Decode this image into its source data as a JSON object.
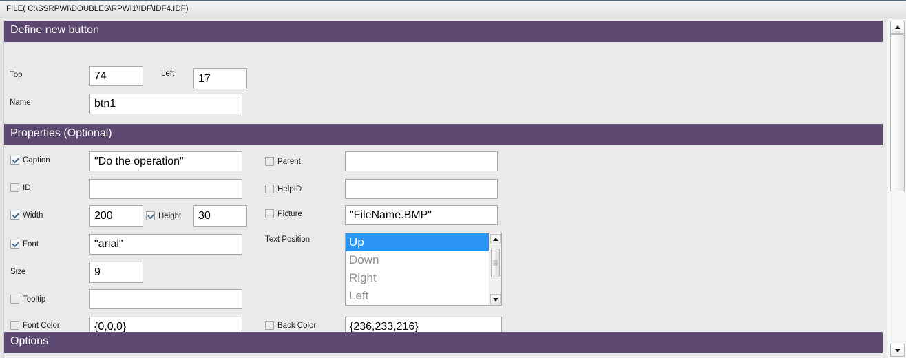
{
  "window": {
    "file_path_label": "FILE( C:\\SSRPWI\\DOUBLES\\RPWI1\\IDF\\IDF4.IDF)"
  },
  "colors": {
    "section_header_bg": "#5d4871",
    "panel_bg": "#eaeaea",
    "selection_blue": "#2a95f2",
    "input_bg": "#ffffff",
    "text": "#242424"
  },
  "sections": {
    "define": {
      "title": "Define new button",
      "fields": {
        "top_label": "Top",
        "top_value": "74",
        "left_label": "Left",
        "left_value": "17",
        "name_label": "Name",
        "name_value": "btn1"
      }
    },
    "properties": {
      "title": "Properties (Optional)",
      "left_column": [
        {
          "name": "caption",
          "label": "Caption",
          "checked": true,
          "has_checkbox": true,
          "value": "\"Do the operation\""
        },
        {
          "name": "id",
          "label": "ID",
          "checked": false,
          "has_checkbox": true,
          "value": ""
        },
        {
          "name": "width",
          "label": "Width",
          "checked": true,
          "has_checkbox": true,
          "value": "200"
        },
        {
          "name": "height",
          "label": "Height",
          "checked": true,
          "has_checkbox": true,
          "value": "30"
        },
        {
          "name": "font",
          "label": "Font",
          "checked": true,
          "has_checkbox": true,
          "value": "\"arial\""
        },
        {
          "name": "size",
          "label": "Size",
          "checked": false,
          "has_checkbox": false,
          "value": "9"
        },
        {
          "name": "tooltip",
          "label": "Tooltip",
          "checked": false,
          "has_checkbox": true,
          "value": ""
        },
        {
          "name": "font-color",
          "label": "Font Color",
          "checked": false,
          "has_checkbox": true,
          "value": "{0,0,0}"
        }
      ],
      "right_column": [
        {
          "name": "parent",
          "label": "Parent",
          "checked": false,
          "has_checkbox": true,
          "value": ""
        },
        {
          "name": "help-id",
          "label": "HelpID",
          "checked": false,
          "has_checkbox": true,
          "value": ""
        },
        {
          "name": "picture",
          "label": "Picture",
          "checked": false,
          "has_checkbox": true,
          "value": "\"FileName.BMP\""
        },
        {
          "name": "text-position",
          "label": "Text Position",
          "checked": false,
          "has_checkbox": false,
          "value": ""
        },
        {
          "name": "back-color",
          "label": "Back Color",
          "checked": false,
          "has_checkbox": true,
          "value": "{236,233,216}"
        }
      ],
      "text_position_list": {
        "options": [
          "Up",
          "Down",
          "Right",
          "Left"
        ],
        "selected": "Up"
      }
    },
    "options": {
      "title": "Options"
    }
  }
}
